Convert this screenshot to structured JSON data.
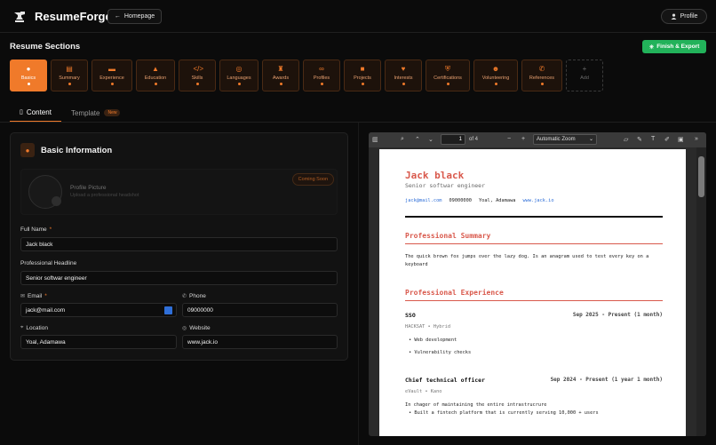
{
  "header": {
    "brand": "ResumeForge",
    "homepage_label": "Homepage",
    "profile_label": "Profile"
  },
  "sections": {
    "title": "Resume Sections",
    "finish_label": "Finish & Export",
    "items": [
      {
        "label": "Basics",
        "icon": "person-icon"
      },
      {
        "label": "Summary",
        "icon": "document-icon"
      },
      {
        "label": "Experience",
        "icon": "briefcase-icon"
      },
      {
        "label": "Education",
        "icon": "graduation-cap-icon"
      },
      {
        "label": "Skills",
        "icon": "code-icon"
      },
      {
        "label": "Languages",
        "icon": "globe-icon"
      },
      {
        "label": "Awards",
        "icon": "trophy-icon"
      },
      {
        "label": "Profiles",
        "icon": "link-icon"
      },
      {
        "label": "Projects",
        "icon": "folder-icon"
      },
      {
        "label": "Interests",
        "icon": "heart-icon"
      },
      {
        "label": "Certifications",
        "icon": "shield-icon"
      },
      {
        "label": "Volunteering",
        "icon": "people-icon"
      },
      {
        "label": "References",
        "icon": "phone-icon"
      },
      {
        "label": "Add",
        "icon": "plus-icon"
      }
    ]
  },
  "tabs": {
    "content": "Content",
    "template": "Template",
    "new_badge": "New"
  },
  "basic_info": {
    "title": "Basic Information",
    "picture_title": "Profile Picture",
    "picture_sub": "Upload a professional headshot",
    "coming_soon": "Coming Soon",
    "full_name_label": "Full Name",
    "full_name": "Jack black",
    "headline_label": "Professional Headline",
    "headline": "Senior softwar engineer",
    "email_label": "Email",
    "email": "jack@mail.com",
    "phone_label": "Phone",
    "phone": "09000000",
    "location_label": "Location",
    "location": "Yoal, Adamawa",
    "website_label": "Website",
    "website": "www.jack.io",
    "required_mark": "*"
  },
  "viewer": {
    "page_current": "1",
    "page_total": "of 4",
    "zoom": "Automatic Zoom",
    "minus": "−",
    "plus": "+"
  },
  "resume": {
    "name": "Jack black",
    "headline": "Senior softwar engineer",
    "email": "jack@mail.com",
    "phone": "09000000",
    "location": "Yoal, Adamawa",
    "website": "www.jack.io",
    "summary_title": "Professional Summary",
    "summary": "The quick brown fox jumps over the lazy dog. Is an anagram used to test every key on a keyboard",
    "experience_title": "Professional Experience",
    "jobs": [
      {
        "title": "SSO",
        "date": "Sep 2025 - Present (1 month)",
        "meta": "HACKSAT • Hybrid",
        "bullets": [
          "• Web development",
          "• Vulnerability checks"
        ]
      },
      {
        "title": "Chief technical officer",
        "date": "Sep 2024 - Present (1 year 1 month)",
        "meta": "eVault • Kano",
        "desc": "In chager of maintaining the entire intrastrucrure",
        "bullets": [
          "• Built a fintech platform that is currently serving 10,000 + users"
        ]
      }
    ]
  }
}
